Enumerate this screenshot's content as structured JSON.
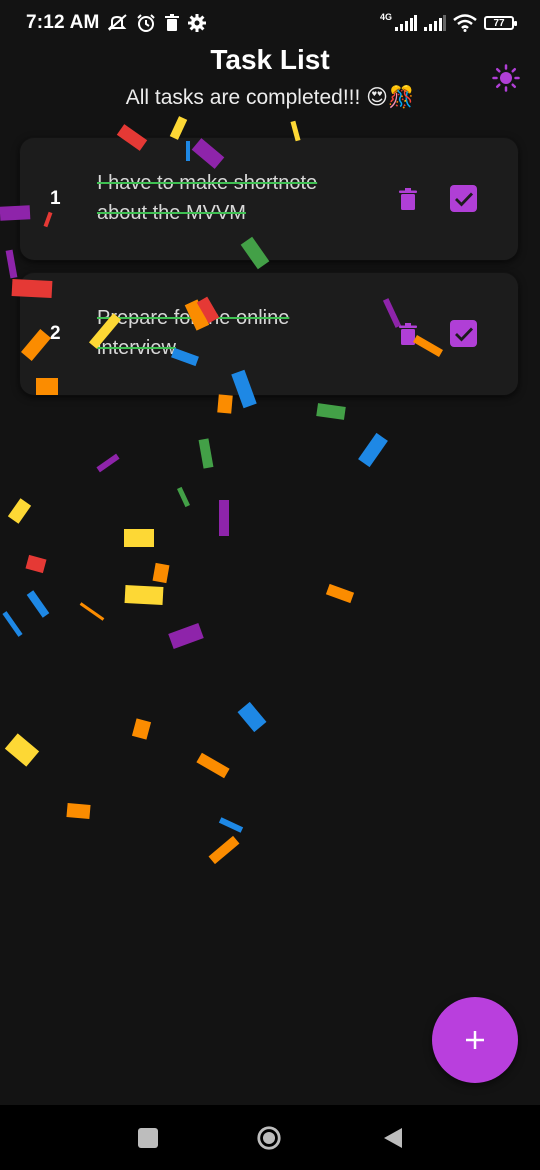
{
  "status_bar": {
    "time": "7:12 AM",
    "network_label": "4G",
    "battery_level": "77",
    "icons": [
      "mute-icon",
      "alarm-icon",
      "trash-icon",
      "settings-icon",
      "signal-icon",
      "signal-icon",
      "wifi-icon",
      "battery-icon"
    ]
  },
  "header": {
    "title": "Task List",
    "subtitle": "All tasks are completed!!! 😍🎊",
    "theme_icon": "sun-icon"
  },
  "tasks": [
    {
      "number": "1",
      "text": "I have to make shortnote about the MVVM",
      "completed": true
    },
    {
      "number": "2",
      "text": "Prepare for the online interview",
      "completed": true
    }
  ],
  "colors": {
    "background": "#131313",
    "card": "#1c1c1c",
    "accent": "#b03fd6",
    "strike": "#3fbf52"
  },
  "fab": {
    "label": "+"
  },
  "nav_bar": {
    "icons": [
      "recent-apps-icon",
      "home-icon",
      "back-icon"
    ]
  }
}
